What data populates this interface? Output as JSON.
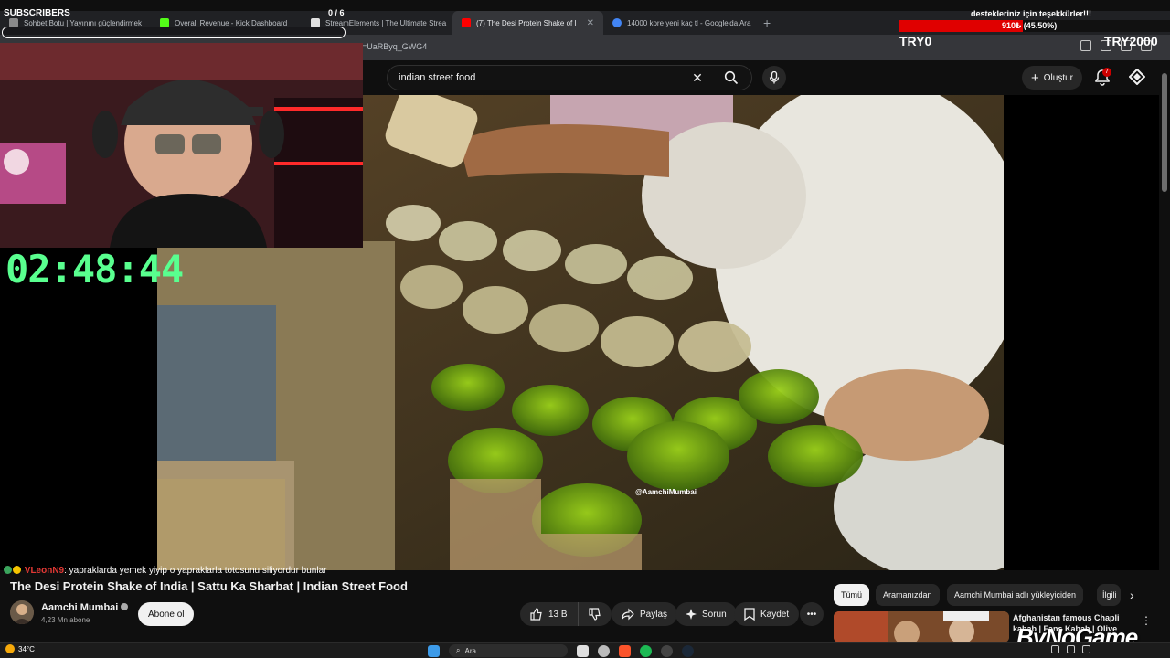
{
  "browser": {
    "tabs": [
      {
        "title": "Sohbet Botu | Yayınını güçlendirmek",
        "color": "#8a8a8a",
        "active": false
      },
      {
        "title": "Overall Revenue - Kick Dashboard",
        "color": "#53fc18",
        "active": false
      },
      {
        "title": "StreamElements | The Ultimate Strea",
        "color": "#e0e0e0",
        "active": false
      },
      {
        "title": "(7) The Desi Protein Shake of I",
        "color": "#ff0000",
        "active": true
      },
      {
        "title": "14000 kore yeni kaç tl - Google'da Ara",
        "color": "#4285f4",
        "active": false
      }
    ],
    "url_fragment": "=UaRByq_GWG4"
  },
  "youtube": {
    "search_query": "indian street food",
    "create_label": "Oluştur",
    "notification_count": "7",
    "video": {
      "title": "The Desi Protein Shake of India | Sattu Ka Sharbat | Indian Street Food",
      "watermark": "@AamchiMumbai"
    },
    "channel": {
      "name": "Aamchi Mumbai",
      "subscribers": "4,23 Mn abone",
      "subscribe_label": "Abone ol"
    },
    "actions": {
      "likes": "13 B",
      "share": "Paylaş",
      "ask": "Sorun",
      "save": "Kaydet"
    },
    "chips": [
      "Tümü",
      "Aramanızdan",
      "Aamchi Mumbai adlı yükleyiciden",
      "İlgili"
    ],
    "recommendation": {
      "title": "Afghanistan famous Chapli kabab | Fans Kabab | Olive"
    }
  },
  "overlay": {
    "subs_title": "SUBSCRIBERS",
    "subs_count": "0 / 6",
    "timer": "02:48:44",
    "donate_title": "destekleriniz için teşekkürler!!!",
    "donate_progress": "910₺ (45.50%)",
    "donate_fraction": 0.455,
    "donate_min": "TRY0",
    "donate_max": "TRY2000",
    "chat": {
      "user": "VLeonN9",
      "message": ": yapraklarda yemek yiyip o yapraklarla totosunu siliyordur bunlar"
    },
    "sponsor": "ByNoGame",
    "colors": {
      "timer": "#59ff8f",
      "donate_bar": "#e00000",
      "chat_user": "#e53935"
    }
  },
  "taskbar": {
    "weather_temp": "34°C",
    "search_placeholder": "Ara"
  }
}
